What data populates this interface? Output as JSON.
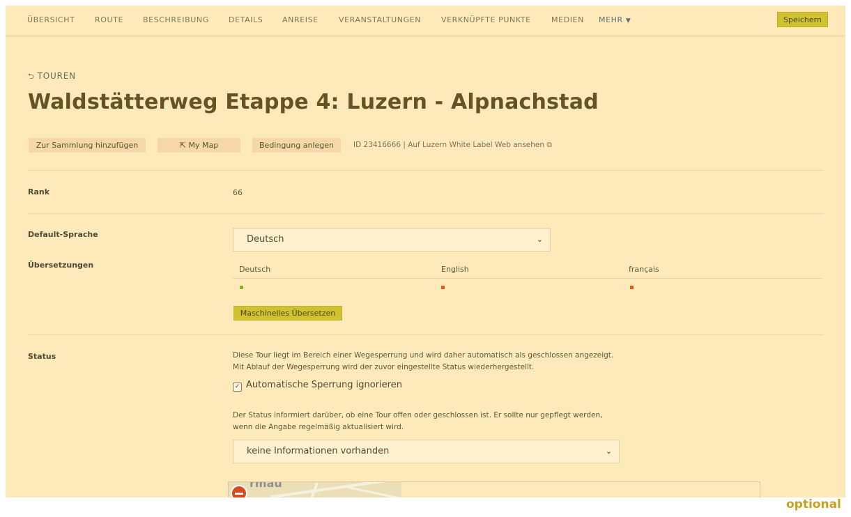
{
  "nav": {
    "items": [
      "ÜBERSICHT",
      "ROUTE",
      "BESCHREIBUNG",
      "DETAILS",
      "ANREISE",
      "VERANSTALTUNGEN",
      "VERKNÜPFTE PUNKTE",
      "MEDIEN"
    ],
    "more_label": "MEHR",
    "save_label": "Speichern"
  },
  "breadcrumb": {
    "back_label": "TOUREN"
  },
  "page": {
    "title": "Waldstätterweg Etappe 4: Luzern - Alpnachstad",
    "actions": {
      "add_collection": "Zur Sammlung hinzufügen",
      "my_map": "My Map",
      "condition": "Bedingung anlegen"
    },
    "id_text": "ID 23416666",
    "view_link": "| Auf Luzern White Label Web ansehen"
  },
  "rank": {
    "label": "Rank",
    "value": "66"
  },
  "default_language": {
    "label": "Default-Sprache",
    "selected": "Deutsch"
  },
  "translations": {
    "label": "Übersetzungen",
    "languages": [
      {
        "name": "Deutsch",
        "status_color": "#7fb62a"
      },
      {
        "name": "English",
        "status_color": "#e25a1c"
      },
      {
        "name": "français",
        "status_color": "#e25a1c"
      }
    ],
    "machine_translate_label": "Maschinelles Übersetzen"
  },
  "status": {
    "label": "Status",
    "closure_info": "Diese Tour liegt im Bereich einer Wegesperrung und wird daher automatisch als geschlossen angezeigt. Mit Ablauf der Wegesperrung wird der zuvor eingestellte Status wiederhergestellt.",
    "ignore_closure_label": "Automatische Sperrung ignorieren",
    "ignore_closure_checked": true,
    "status_info": "Der Status informiert darüber, ob eine Tour offen oder geschlossen ist. Er sollte nur gepflegt werden, wenn die Angabe regelmäßig aktualisiert wird.",
    "selected": "keine Informationen vorhanden"
  },
  "map": {
    "place_label": "rmau"
  },
  "watermark": "optional",
  "colors": {
    "accent": "#d0c130",
    "background": "#fde9b9",
    "ok": "#7fb62a",
    "missing": "#e25a1c"
  },
  "icons": {
    "back": "undo-arrow-icon",
    "my_map": "share-out-icon",
    "external": "external-link-icon",
    "chevron": "chevron-down-icon",
    "checkmark": "checkmark-icon",
    "closure": "no-entry-icon"
  }
}
